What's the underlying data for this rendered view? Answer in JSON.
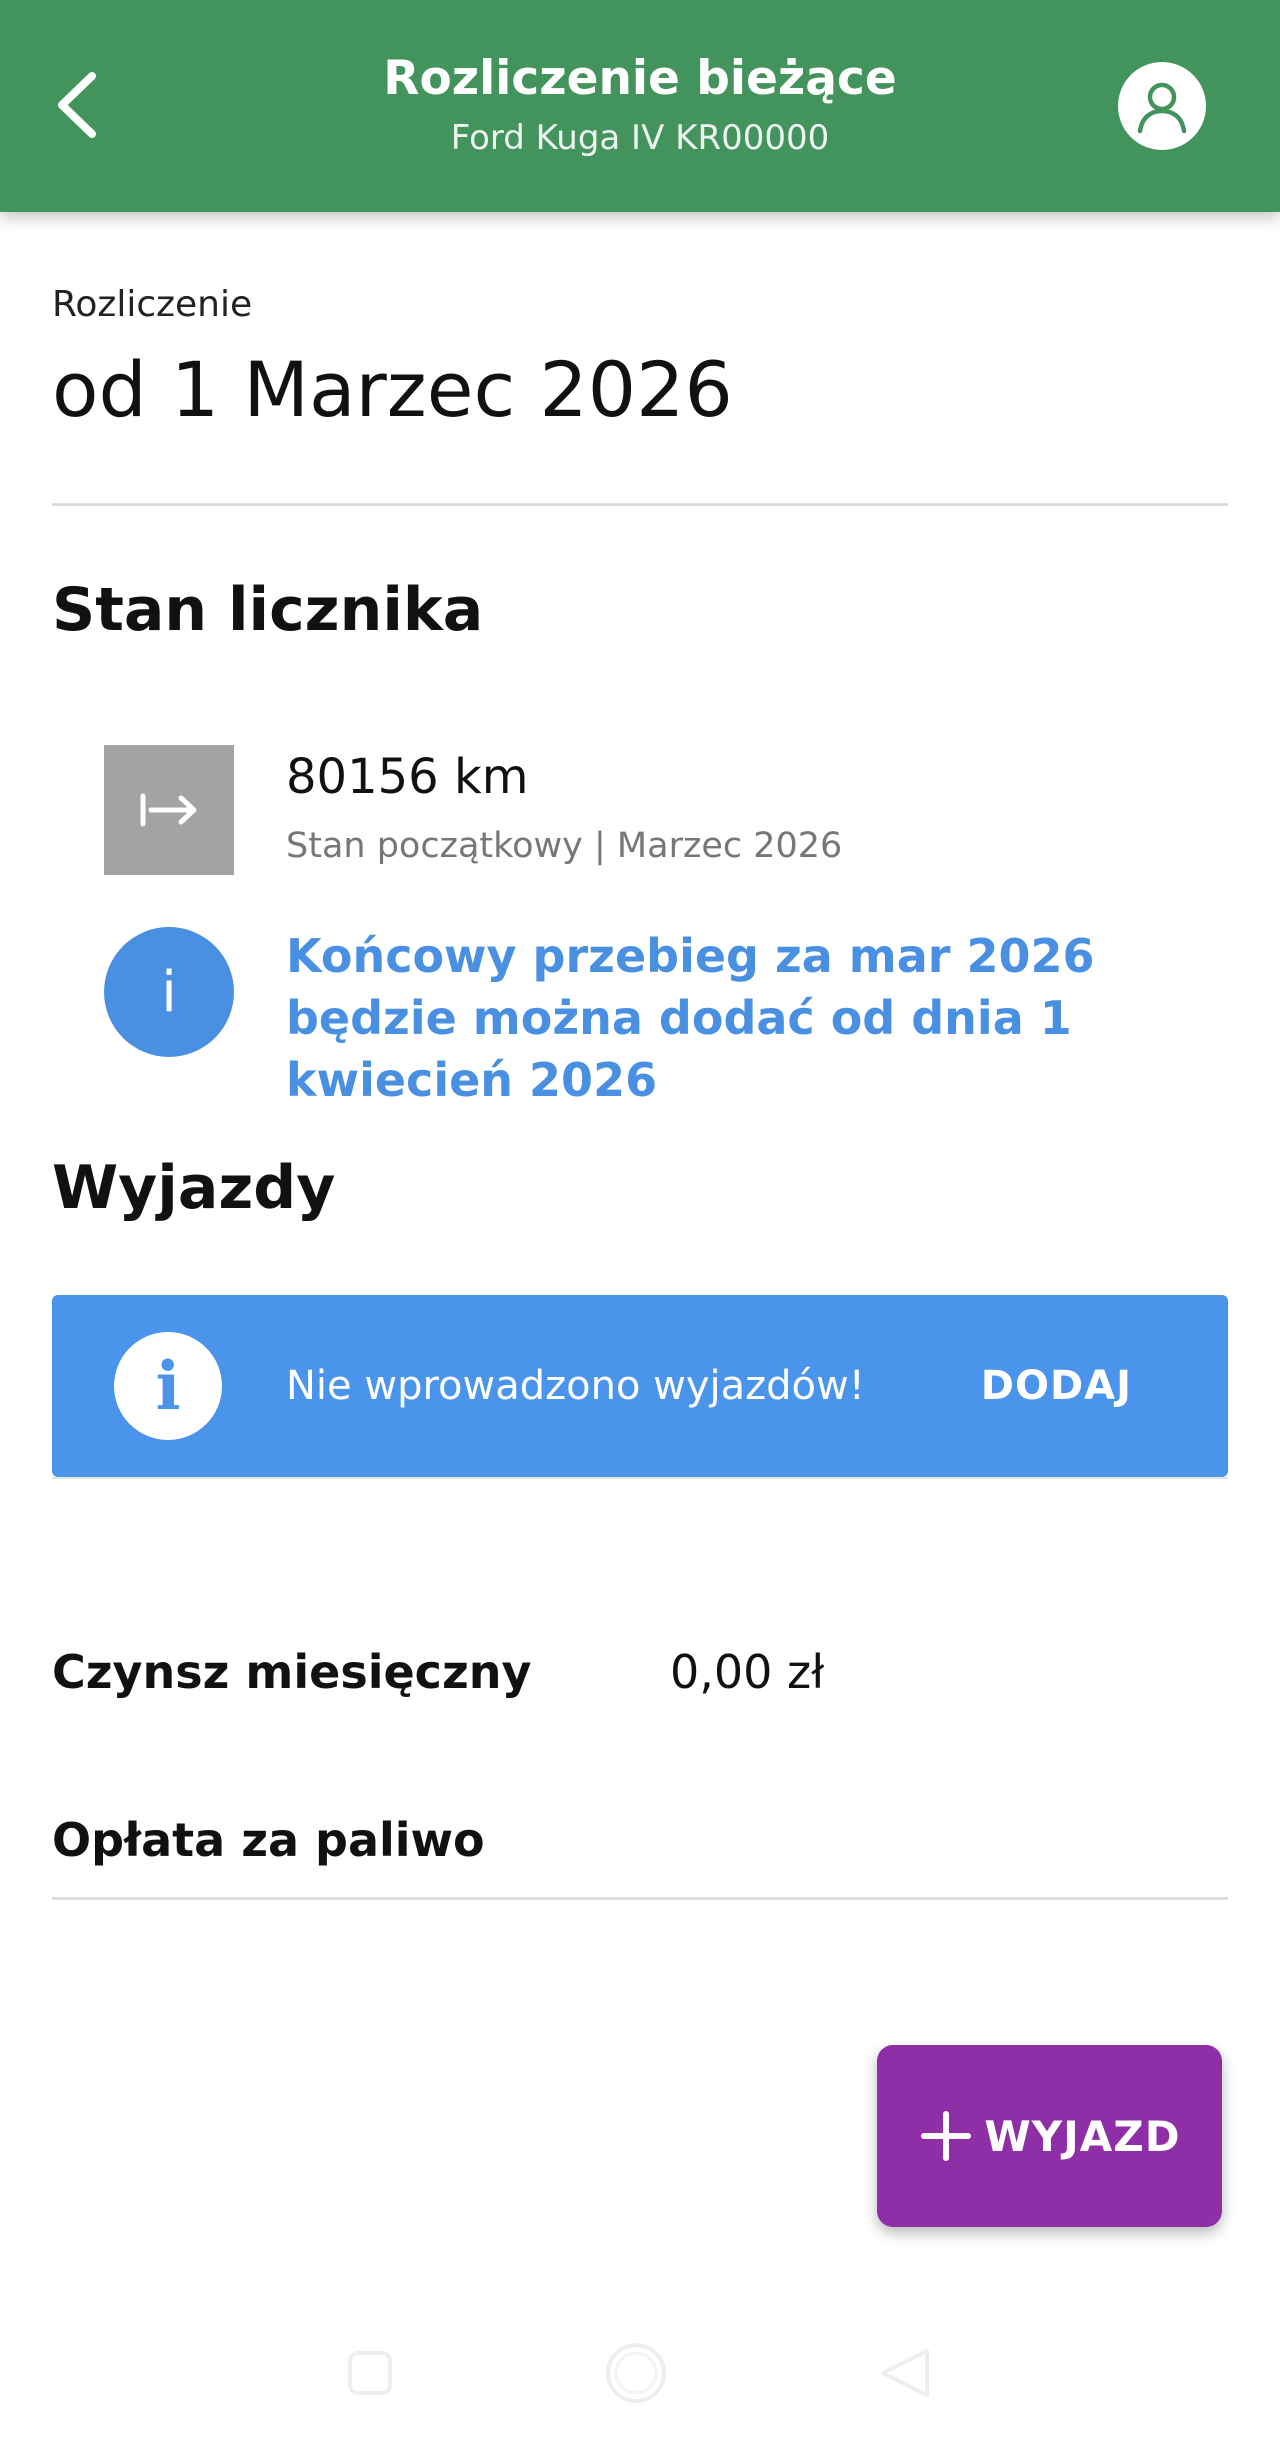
{
  "header": {
    "title": "Rozliczenie bieżące",
    "subtitle": "Ford Kuga IV KR00000",
    "back_icon": "chevron-left-icon",
    "profile_icon": "user-icon",
    "color": "#43945c"
  },
  "period": {
    "label": "Rozliczenie",
    "value": "od 1 Marzec 2026"
  },
  "odometer": {
    "title": "Stan licznika",
    "value": "80156 km",
    "caption": "Stan początkowy | Marzec 2026",
    "icon": "start-arrow-icon",
    "info_message": "Końcowy przebieg za mar 2026 będzie można dodać od dnia 1 kwiecień 2026",
    "info_icon": "info-icon"
  },
  "trips": {
    "title": "Wyjazdy",
    "banner_text": "Nie wprowadzono wyjazdów!",
    "banner_action": "DODAJ",
    "banner_color": "#4a94ec"
  },
  "fees": [
    {
      "label": "Czynsz miesięczny",
      "value": "0,00 zł"
    },
    {
      "label": "Opłata za paliwo",
      "value": ""
    }
  ],
  "fab": {
    "label": "WYJAZD",
    "icon": "plus-icon",
    "color": "#8e2fa8"
  },
  "system_nav": [
    "recents-icon",
    "home-icon",
    "back-icon"
  ]
}
